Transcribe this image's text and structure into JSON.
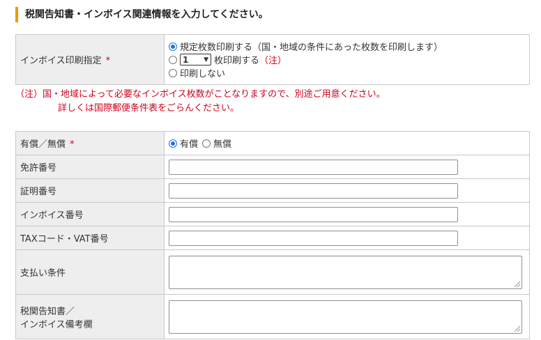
{
  "section_title": "税関告知書・インボイス関連情報を入力してください。",
  "required_mark": "*",
  "invoice_print": {
    "label": "インボイス印刷指定",
    "option1": "規定枚数印刷する（国・地域の条件にあった枚数を印刷します）",
    "option2_count": "1",
    "option2_text": "枚印刷する",
    "option2_note": "（注）",
    "option3": "印刷しない",
    "selected": "option1"
  },
  "note": {
    "line1": "（注）国・地域によって必要なインボイス枚数がことなりますので、別途ご用意ください。",
    "line2": "詳しくは国際郵便条件表をごらんください。"
  },
  "fields": {
    "paid_label": "有償／無償",
    "paid_option": "有償",
    "free_option": "無償",
    "paid_selected": "paid",
    "license_label": "免許番号",
    "license_value": "",
    "cert_label": "証明番号",
    "cert_value": "",
    "invoice_no_label": "インボイス番号",
    "invoice_no_value": "",
    "tax_label": "TAXコード・VAT番号",
    "tax_value": "",
    "payment_label": "支払い条件",
    "payment_value": "",
    "remarks_label_1": "税関告知書／",
    "remarks_label_2": "インボイス備考欄",
    "remarks_value": ""
  },
  "colors": {
    "accent": "#f0960e",
    "required": "#d0021b",
    "label_bg": "#eeeeee",
    "radio_selected": "#1a73e8"
  }
}
